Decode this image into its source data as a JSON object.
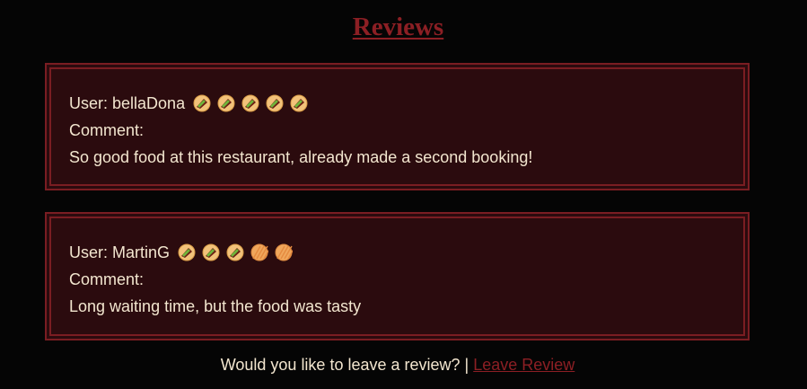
{
  "page": {
    "title": "Reviews"
  },
  "reviews": [
    {
      "user_label": "User:",
      "username": "bellaDona",
      "rating": 5,
      "rating_max": 5,
      "comment_label": "Comment:",
      "comment": "So good food at this restaurant, already made a second booking!"
    },
    {
      "user_label": "User:",
      "username": "MartinG",
      "rating": 3,
      "rating_max": 5,
      "comment_label": "Comment:",
      "comment": "Long waiting time, but the food was tasty"
    }
  ],
  "footer": {
    "prompt": "Would you like to leave a review?",
    "separator": "|",
    "link_label": "Leave Review"
  },
  "icons": {
    "rating_filled": "taco-filled-icon",
    "rating_empty": "taco-empty-icon"
  },
  "colors": {
    "background": "#050505",
    "card_background": "#2b0b0e",
    "accent": "#8c1f24",
    "text": "#f3e6cf"
  }
}
